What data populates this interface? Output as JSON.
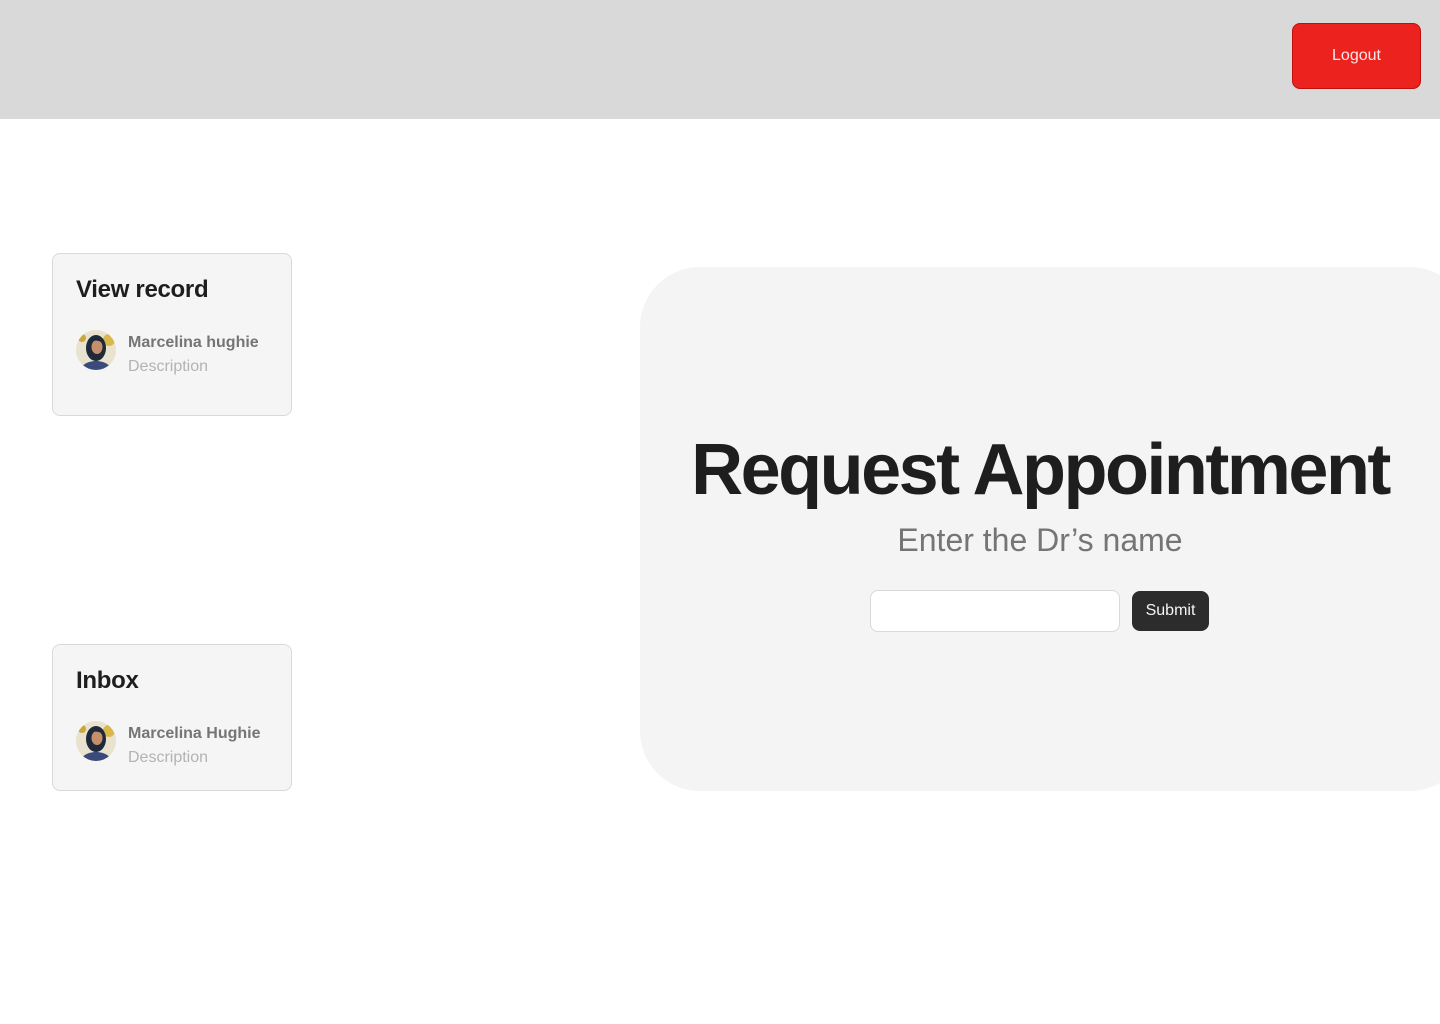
{
  "header": {
    "logout_label": "Logout"
  },
  "cards": {
    "record": {
      "title": "View record",
      "user_name": "Marcelina hughie",
      "description": "Description"
    },
    "inbox": {
      "title": "Inbox",
      "user_name": "Marcelina Hughie",
      "description": "Description"
    }
  },
  "appointment": {
    "heading": "Request Appointment",
    "subheading": "Enter the Dr’s name",
    "input_value": "",
    "submit_label": "Submit"
  },
  "colors": {
    "topbar": "#d9d9d9",
    "logout": "#ec221f",
    "panel": "#f4f4f4",
    "submit": "#2c2c2c"
  }
}
